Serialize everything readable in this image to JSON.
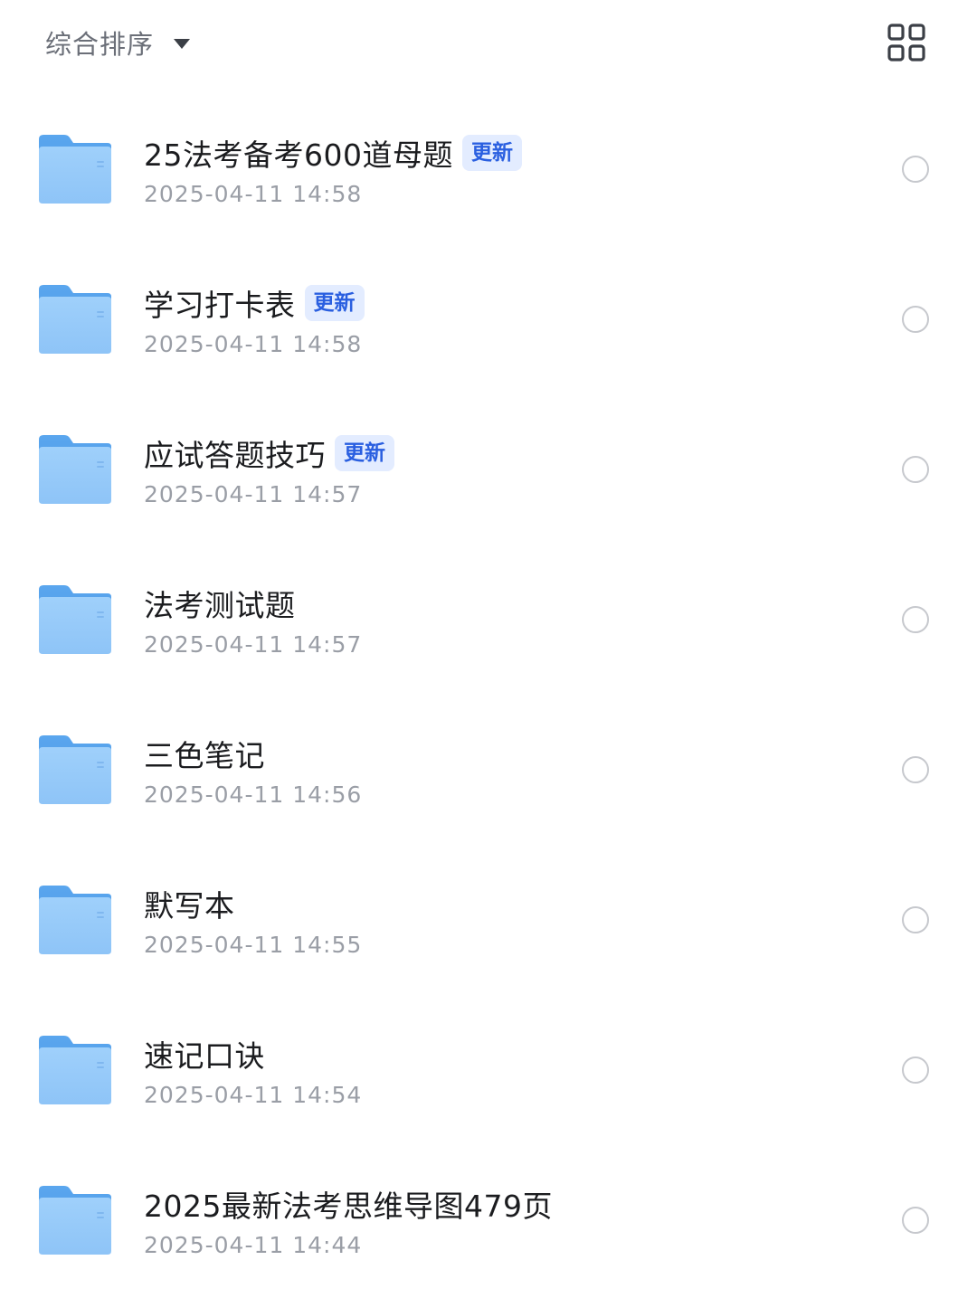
{
  "toolbar": {
    "sort_label": "综合排序",
    "sort_icon": "caret-down-icon",
    "view_toggle_icon": "grid-view-icon"
  },
  "colors": {
    "folder_light": "#9fd0fb",
    "folder_dark": "#5aa6ee",
    "badge_bg": "#e3ecff",
    "badge_text": "#2a5fe0"
  },
  "files": [
    {
      "name": "25法考备考600道母题",
      "badge": "更新",
      "date": "2025-04-11 14:58",
      "icon": "folder-icon"
    },
    {
      "name": "学习打卡表",
      "badge": "更新",
      "date": "2025-04-11 14:58",
      "icon": "folder-icon"
    },
    {
      "name": "应试答题技巧",
      "badge": "更新",
      "date": "2025-04-11 14:57",
      "icon": "folder-icon"
    },
    {
      "name": "法考测试题",
      "badge": "",
      "date": "2025-04-11 14:57",
      "icon": "folder-icon"
    },
    {
      "name": "三色笔记",
      "badge": "",
      "date": "2025-04-11 14:56",
      "icon": "folder-icon"
    },
    {
      "name": "默写本",
      "badge": "",
      "date": "2025-04-11 14:55",
      "icon": "folder-icon"
    },
    {
      "name": "速记口诀",
      "badge": "",
      "date": "2025-04-11 14:54",
      "icon": "folder-icon"
    },
    {
      "name": "2025最新法考思维导图479页",
      "badge": "",
      "date": "2025-04-11 14:44",
      "icon": "folder-icon"
    }
  ]
}
